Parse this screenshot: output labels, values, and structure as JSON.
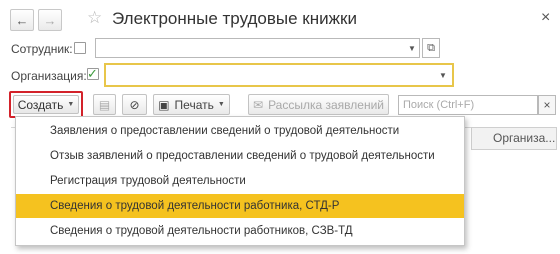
{
  "header": {
    "back_icon": "←",
    "forward_icon": "→",
    "star_icon": "☆",
    "title": "Электронные трудовые книжки",
    "close_icon": "×"
  },
  "filters": {
    "employee": {
      "label": "Сотрудник:",
      "checked": false,
      "value": ""
    },
    "organization": {
      "label": "Организация:",
      "checked": true,
      "value": ""
    }
  },
  "toolbar": {
    "create_label": "Создать",
    "print_label": "Печать",
    "mailing_label": "Рассылка заявлений",
    "search_placeholder": "Поиск (Ctrl+F)",
    "search_clear": "×"
  },
  "table": {
    "columns": [
      "Организа..."
    ]
  },
  "create_menu": {
    "items": [
      {
        "label": "Заявления о предоставлении сведений о трудовой деятельности",
        "selected": false
      },
      {
        "label": "Отзыв заявлений о предоставлении сведений о трудовой деятельности",
        "selected": false
      },
      {
        "label": "Регистрация трудовой деятельности",
        "selected": false
      },
      {
        "label": "Сведения о трудовой деятельности работника, СТД-Р",
        "selected": true
      },
      {
        "label": "Сведения о трудовой деятельности работников, СЗВ-ТД",
        "selected": false
      }
    ]
  },
  "colors": {
    "selected_item": "#f5c21f",
    "highlight_border": "#d3222a",
    "organization_field_border": "#e8c64a",
    "check": "#3c9a3c"
  }
}
